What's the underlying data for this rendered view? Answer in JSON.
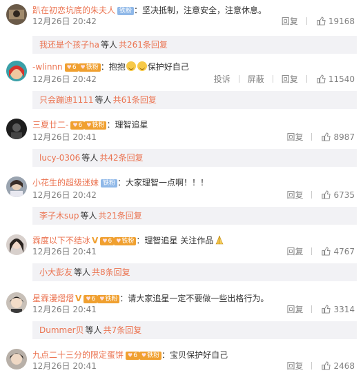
{
  "comments": [
    {
      "username": "趴在初恋坑底的朱夫人",
      "badges": [
        "铁粉"
      ],
      "text": "坚决抵制，注意安全，注意休息。",
      "time": "12月26日 20:42",
      "actions": [
        "回复"
      ],
      "likes": "19168",
      "reply_summary": {
        "user": "我还是个孩子ha",
        "mid": "等人",
        "more": "共261条回复"
      }
    },
    {
      "username": "-wlinnn",
      "badges": [
        "6",
        "铁粉"
      ],
      "text": "抱抱",
      "text_after": "保护好自己",
      "time": "12月26日 20:42",
      "actions": [
        "投诉",
        "屏蔽",
        "回复"
      ],
      "likes": "11540",
      "reply_summary": {
        "user": "只会蹦迪1111",
        "mid": "等人",
        "more": "共61条回复"
      }
    },
    {
      "username": "三夏廿二-",
      "badges": [
        "6",
        "铁粉"
      ],
      "text": "理智追星",
      "time": "12月26日 20:41",
      "actions": [
        "回复"
      ],
      "likes": "8987",
      "reply_summary": {
        "user": "lucy-0306",
        "mid": "等人",
        "more": "共42条回复"
      }
    },
    {
      "username": "小花生的超级迷妹",
      "badges": [
        "铁粉"
      ],
      "text": "大家理智一点啊！！！",
      "time": "12月26日 20:42",
      "actions": [
        "回复"
      ],
      "likes": "6735",
      "reply_summary": {
        "user": "李子木sup",
        "mid": "等人",
        "more": "共21条回复"
      }
    },
    {
      "username": "霖度以下不结冰",
      "badges": [
        "6",
        "铁粉"
      ],
      "verified": true,
      "text": "理智追星 关注作品",
      "time": "12月26日 20:41",
      "actions": [
        "回复"
      ],
      "likes": "4767",
      "reply_summary": {
        "user": "小大彭友",
        "mid": "等人",
        "more": "共8条回复"
      }
    },
    {
      "username": "星霖漫熠熠",
      "badges": [
        "6",
        "铁粉"
      ],
      "verified": true,
      "text": "请大家追星一定不要做一些出格行为。",
      "time": "12月26日 20:41",
      "actions": [
        "回复"
      ],
      "likes": "3314",
      "reply_summary": {
        "user": "Dummer贝",
        "mid": "等人",
        "more": "共7条回复"
      }
    },
    {
      "username": "九点二十三分的限定蛋饼",
      "badges": [
        "6",
        "铁粉"
      ],
      "text": "宝贝保护好自己",
      "time": "12月26日 20:41",
      "actions": [
        "回复"
      ],
      "likes": "2468"
    }
  ],
  "colors": {
    "username": "#eb7350",
    "meta": "#808080",
    "reply_bg": "#f2f2f5",
    "fans_badge": "#8fb8e8",
    "vip_badge": "#f0a030"
  }
}
